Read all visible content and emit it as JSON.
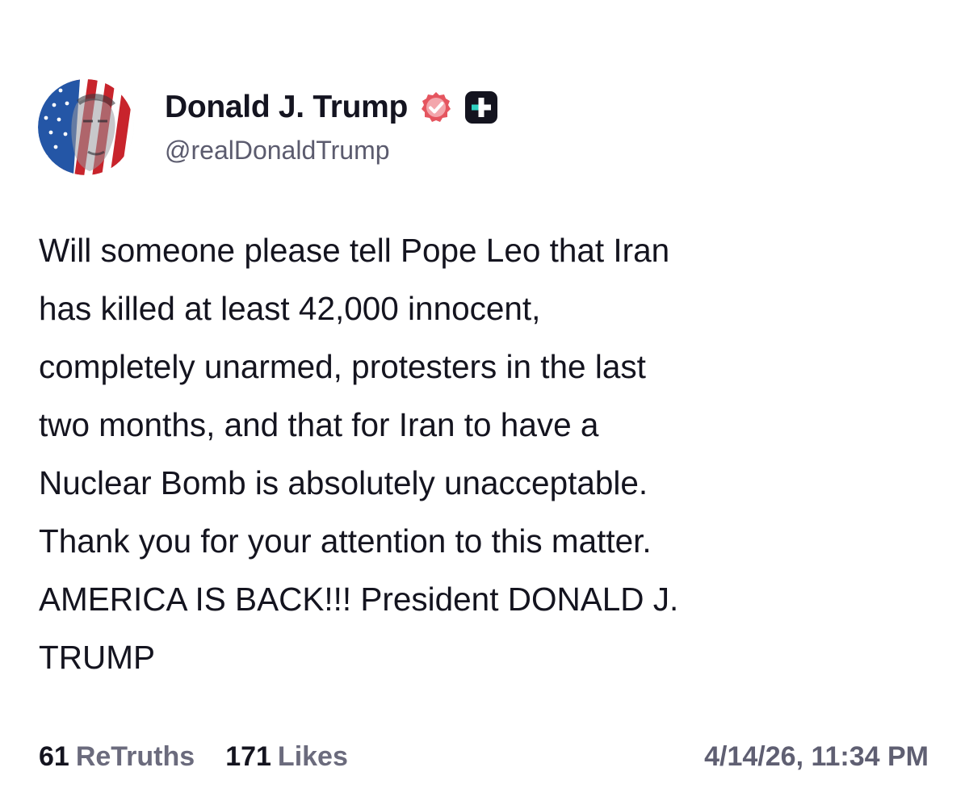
{
  "author": {
    "display_name": "Donald J. Trump",
    "handle": "@realDonaldTrump",
    "verified_icon": "verified-badge-icon",
    "plus_icon": "plus-badge-icon",
    "verified_color": "#e5555f"
  },
  "post": {
    "text": "Will someone please tell Pope Leo that Iran\nhas killed at least 42,000 innocent,\ncompletely unarmed, protesters in the last\ntwo months, and that for Iran to have a\nNuclear Bomb is absolutely unacceptable.\nThank you for your attention to this matter.\nAMERICA IS BACK!!! President DONALD J.\nTRUMP"
  },
  "stats": {
    "retruths_count": "61",
    "retruths_label": "ReTruths",
    "likes_count": "171",
    "likes_label": "Likes",
    "timestamp": "4/14/26, 11:34 PM"
  }
}
